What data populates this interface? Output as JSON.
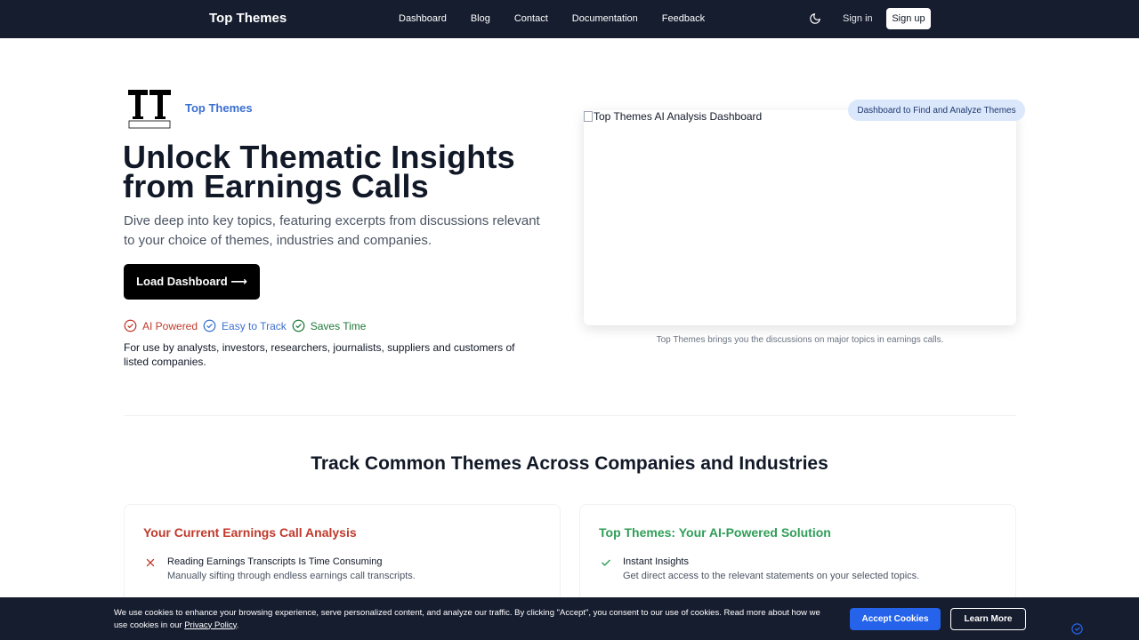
{
  "nav": {
    "brand": "Top Themes",
    "links": [
      "Dashboard",
      "Blog",
      "Contact",
      "Documentation",
      "Feedback"
    ],
    "theme_toggle_icon": "moon-icon",
    "sign_in": "Sign in",
    "sign_up": "Sign up"
  },
  "hero": {
    "logo_text": "Top Themes",
    "title": "Unlock Thematic Insights from Earnings Calls",
    "subtitle": "Dive deep into key topics, featuring excerpts from discussions relevant to your choice of themes, industries and companies.",
    "cta": "Load Dashboard ⟶",
    "features": [
      {
        "label": "AI Powered",
        "color": "#c0392b"
      },
      {
        "label": "Easy to Track",
        "color": "#3b6fd1"
      },
      {
        "label": "Saves Time",
        "color": "#1f7a3a"
      }
    ],
    "usage": "For use by analysts, investors, researchers, journalists, suppliers and customers of listed companies.",
    "image_alt": "Top Themes AI Analysis Dashboard",
    "pill": "Dashboard to Find and Analyze Themes",
    "caption": "Top Themes brings you the discussions on major topics in earnings calls."
  },
  "section": {
    "title": "Track Common Themes Across Companies and Industries",
    "left_card": {
      "title": "Your Current Earnings Call Analysis",
      "item_title": "Reading Earnings Transcripts Is Time Consuming",
      "item_desc": "Manually sifting through endless earnings call transcripts."
    },
    "right_card": {
      "title": "Top Themes: Your AI-Powered Solution",
      "item_title": "Instant Insights",
      "item_desc": "Get direct access to the relevant statements on your selected topics."
    }
  },
  "cookie": {
    "text": "We use cookies to enhance your browsing experience, serve personalized content, and analyze our traffic. By clicking \"Accept\", you consent to our use of cookies. Read more about how we use cookies in our ",
    "link": "Privacy Policy",
    "end": ".",
    "accept": "Accept Cookies",
    "learn_more": "Learn More"
  }
}
